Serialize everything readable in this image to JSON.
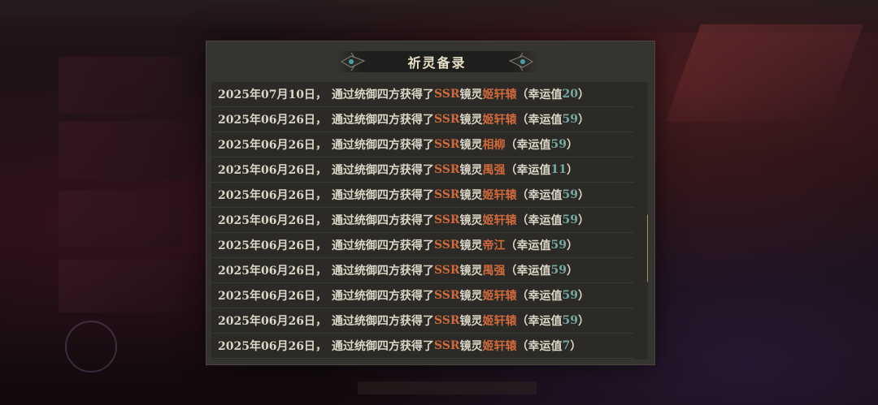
{
  "modal": {
    "title": "祈灵备录",
    "records": [
      {
        "date": "2025年07月10日",
        "sep": "，",
        "action": "通过统御四方获得了",
        "rarity": "SSR",
        "type": "镜灵",
        "name": "姬轩辕",
        "luck_open": "（幸运值",
        "luck": "20",
        "luck_close": "）"
      },
      {
        "date": "2025年06月26日",
        "sep": "，",
        "action": "通过统御四方获得了",
        "rarity": "SSR",
        "type": "镜灵",
        "name": "姬轩辕",
        "luck_open": "（幸运值",
        "luck": "59",
        "luck_close": "）"
      },
      {
        "date": "2025年06月26日",
        "sep": "，",
        "action": "通过统御四方获得了",
        "rarity": "SSR",
        "type": "镜灵",
        "name": "相柳",
        "luck_open": "（幸运值",
        "luck": "59",
        "luck_close": "）"
      },
      {
        "date": "2025年06月26日",
        "sep": "，",
        "action": "通过统御四方获得了",
        "rarity": "SSR",
        "type": "镜灵",
        "name": "禺强",
        "luck_open": "（幸运值",
        "luck": "11",
        "luck_close": "）"
      },
      {
        "date": "2025年06月26日",
        "sep": "，",
        "action": "通过统御四方获得了",
        "rarity": "SSR",
        "type": "镜灵",
        "name": "姬轩辕",
        "luck_open": "（幸运值",
        "luck": "59",
        "luck_close": "）"
      },
      {
        "date": "2025年06月26日",
        "sep": "，",
        "action": "通过统御四方获得了",
        "rarity": "SSR",
        "type": "镜灵",
        "name": "姬轩辕",
        "luck_open": "（幸运值",
        "luck": "59",
        "luck_close": "）"
      },
      {
        "date": "2025年06月26日",
        "sep": "，",
        "action": "通过统御四方获得了",
        "rarity": "SSR",
        "type": "镜灵",
        "name": "帝江",
        "luck_open": "（幸运值",
        "luck": "59",
        "luck_close": "）"
      },
      {
        "date": "2025年06月26日",
        "sep": "，",
        "action": "通过统御四方获得了",
        "rarity": "SSR",
        "type": "镜灵",
        "name": "禺强",
        "luck_open": "（幸运值",
        "luck": "59",
        "luck_close": "）"
      },
      {
        "date": "2025年06月26日",
        "sep": "，",
        "action": "通过统御四方获得了",
        "rarity": "SSR",
        "type": "镜灵",
        "name": "姬轩辕",
        "luck_open": "（幸运值",
        "luck": "59",
        "luck_close": "）"
      },
      {
        "date": "2025年06月26日",
        "sep": "，",
        "action": "通过统御四方获得了",
        "rarity": "SSR",
        "type": "镜灵",
        "name": "姬轩辕",
        "luck_open": "（幸运值",
        "luck": "59",
        "luck_close": "）"
      },
      {
        "date": "2025年06月26日",
        "sep": "，",
        "action": "通过统御四方获得了",
        "rarity": "SSR",
        "type": "镜灵",
        "name": "姬轩辕",
        "luck_open": "（幸运值",
        "luck": "7",
        "luck_close": "）"
      }
    ]
  },
  "colors": {
    "panel": "#363430",
    "list_bg": "#2b2a27",
    "text": "#dcd6c6",
    "highlight": "#d06a3c",
    "luck_value": "#78a8a2",
    "scrollbar": "#a6926a"
  }
}
